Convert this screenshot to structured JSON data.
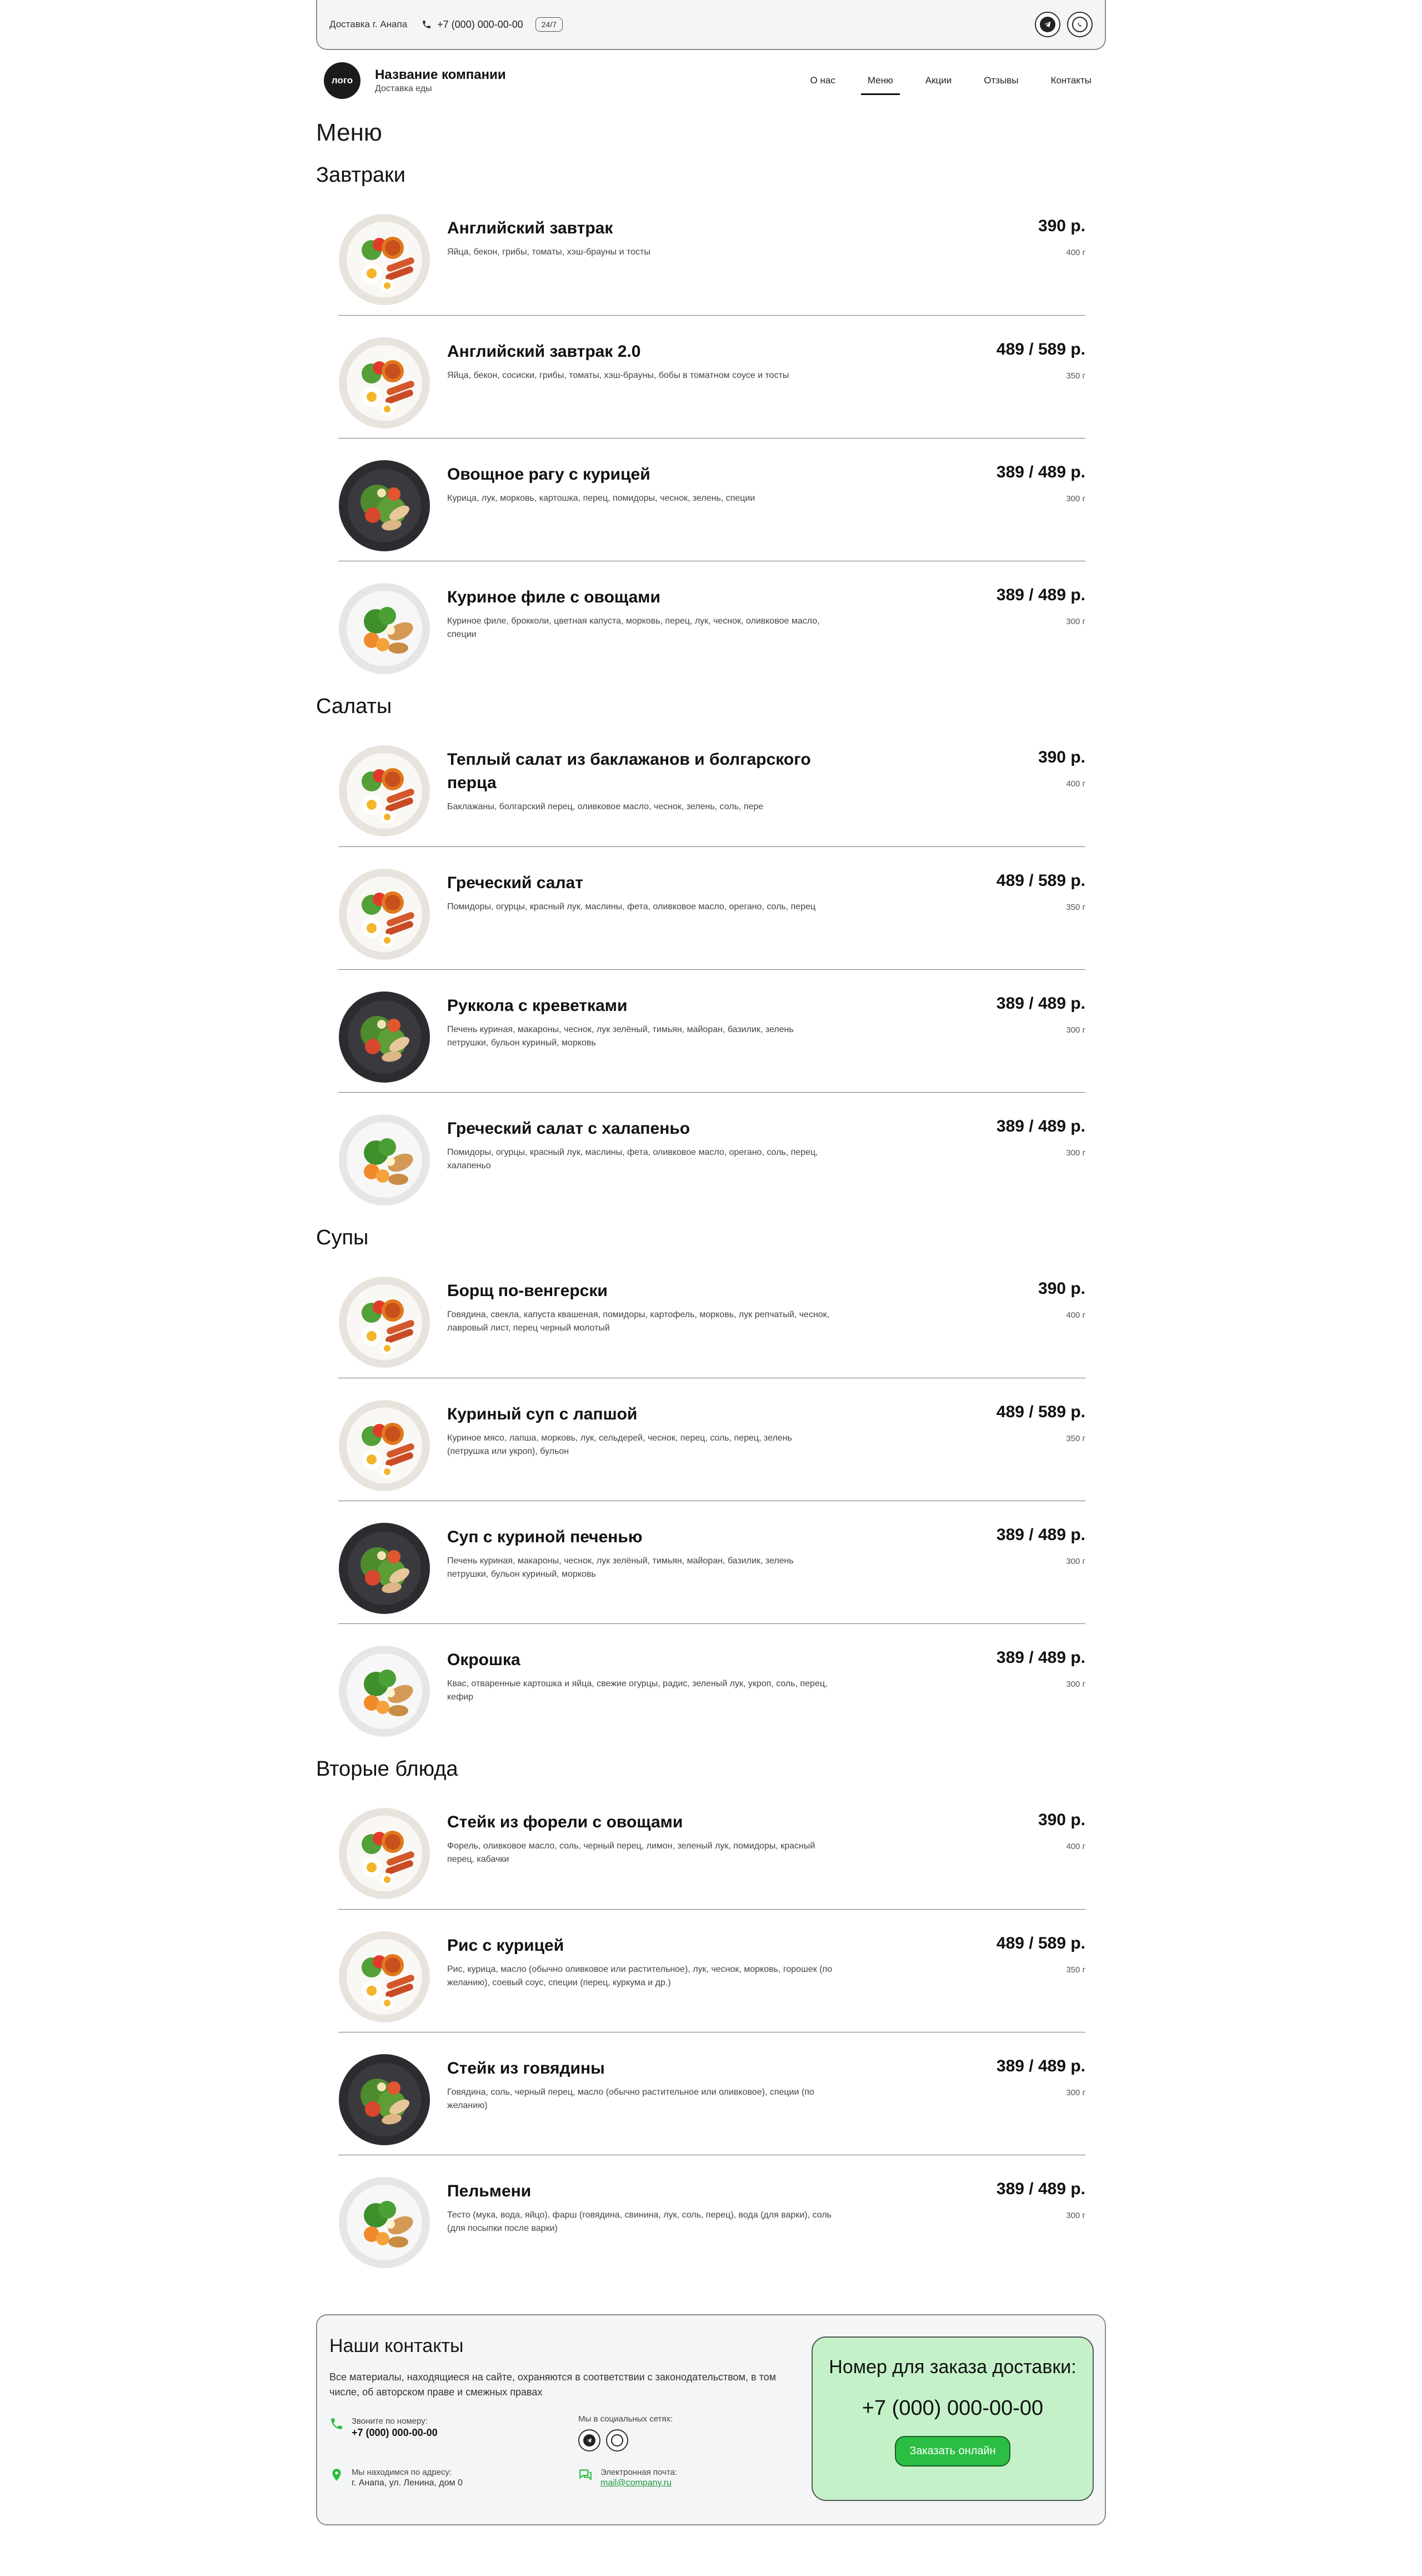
{
  "topbar": {
    "city": "Доставка г. Анапа",
    "phone": "+7 (000) 000-00-00",
    "badge": "24/7",
    "socials": [
      "telegram-icon",
      "whatsapp-icon"
    ]
  },
  "header": {
    "logo": "лого",
    "company_name": "Название компании",
    "company_sub": "Доставка еды",
    "nav": [
      {
        "label": "О нас",
        "active": false
      },
      {
        "label": "Меню",
        "active": true
      },
      {
        "label": "Акции",
        "active": false
      },
      {
        "label": "Отзывы",
        "active": false
      },
      {
        "label": "Контакты",
        "active": false
      }
    ]
  },
  "page_title": "Меню",
  "categories": [
    {
      "title": "Завтраки",
      "dishes": [
        {
          "title": "Английский завтрак",
          "desc": "Яйца, бекон, грибы, томаты, хэш-брауны и тосты",
          "price": "390 р.",
          "weight": "400 г",
          "plate": "light-breakfast"
        },
        {
          "title": "Английский завтрак 2.0",
          "desc": "Яйца, бекон, сосиски, грибы, томаты, хэш-брауны, бобы в томатном соусе и тосты",
          "price": "489 / 589 р.",
          "weight": "350 г",
          "plate": "light-breakfast"
        },
        {
          "title": "Овощное рагу с курицей",
          "desc": "Курица, лук, морковь, картошка, перец, помидоры, чеснок, зелень, специи",
          "price": "389 / 489 р.",
          "weight": "300 г",
          "plate": "dark-salad"
        },
        {
          "title": "Куриное филе с овощами",
          "desc": "Куриное филе, брокколи, цветная капуста, морковь, перец, лук, чеснок, оливковое масло, специи",
          "price": "389 / 489 р.",
          "weight": "300 г",
          "plate": "light-veg"
        }
      ]
    },
    {
      "title": "Салаты",
      "dishes": [
        {
          "title": "Теплый салат из баклажанов и болгарского перца",
          "desc": "Баклажаны, болгарский перец, оливковое масло, чеснок, зелень, соль, пере",
          "price": "390 р.",
          "weight": "400 г",
          "plate": "light-breakfast"
        },
        {
          "title": "Греческий салат",
          "desc": "Помидоры, огурцы, красный лук, маслины, фета, оливковое масло, орегано, соль, перец",
          "price": "489 / 589 р.",
          "weight": "350 г",
          "plate": "light-breakfast"
        },
        {
          "title": "Руккола с креветками",
          "desc": "Печень куриная, макароны, чеснок, лук зелёный, тимьян, майоран, базилик, зелень петрушки, бульон куриный, морковь",
          "price": "389 / 489 р.",
          "weight": "300 г",
          "plate": "dark-salad"
        },
        {
          "title": "Греческий салат с халапеньо",
          "desc": "Помидоры, огурцы, красный лук, маслины, фета, оливковое масло, орегано, соль, перец, халапеньо",
          "price": "389 / 489 р.",
          "weight": "300 г",
          "plate": "light-veg"
        }
      ]
    },
    {
      "title": "Супы",
      "dishes": [
        {
          "title": "Борщ по-венгерски",
          "desc": "Говядина, свекла, капуста квашеная, помидоры, картофель, морковь, лук репчатый, чеснок, лавровый лист, перец черный молотый",
          "price": "390 р.",
          "weight": "400 г",
          "plate": "light-breakfast"
        },
        {
          "title": "Куриный суп с лапшой",
          "desc": "Куриное мясо, лапша, морковь, лук, сельдерей, чеснок, перец, соль, перец, зелень (петрушка или укроп), бульон",
          "price": "489 / 589 р.",
          "weight": "350 г",
          "plate": "light-breakfast"
        },
        {
          "title": "Суп с куриной печенью",
          "desc": "Печень куриная, макароны, чеснок, лук зелёный, тимьян, майоран, базилик, зелень петрушки, бульон куриный, морковь",
          "price": "389 / 489 р.",
          "weight": "300 г",
          "plate": "dark-salad"
        },
        {
          "title": "Окрошка",
          "desc": "Квас, отваренные картошка и яйца, свежие огурцы, радис, зеленый лук, укроп, соль, перец, кефир",
          "price": "389 / 489 р.",
          "weight": "300 г",
          "plate": "light-veg"
        }
      ]
    },
    {
      "title": "Вторые блюда",
      "dishes": [
        {
          "title": "Стейк из форели с овощами",
          "desc": "Форель, оливковое масло, соль, черный перец, лимон, зеленый лук, помидоры, красный перец, кабачки",
          "price": "390 р.",
          "weight": "400 г",
          "plate": "light-breakfast"
        },
        {
          "title": "Рис с курицей",
          "desc": "Рис, курица, масло (обычно оливковое или растительное), лук, чеснок, морковь, горошек (по желанию), соевый соус, специи (перец, куркума и др.)",
          "price": "489 / 589 р.",
          "weight": "350 г",
          "plate": "light-breakfast"
        },
        {
          "title": "Стейк из говядины",
          "desc": "Говядина, соль, черный перец, масло (обычно растительное или оливковое), специи (по желанию)",
          "price": "389 / 489 р.",
          "weight": "300 г",
          "plate": "dark-salad"
        },
        {
          "title": "Пельмени",
          "desc": "Тесто (мука, вода, яйцо), фарш (говядина, свинина, лук, соль, перец), вода (для варки), соль (для посыпки после варки)",
          "price": "389 / 489 р.",
          "weight": "300 г",
          "plate": "light-veg"
        }
      ]
    }
  ],
  "footer": {
    "title": "Наши контакты",
    "note": "Все материалы, находящиеся на сайте, охраняются в соответствии с законодательством, в том числе, об авторском праве и смежных правах",
    "call_label": "Звоните по номеру:",
    "call_value": "+7 (000) 000-00-00",
    "social_label": "Мы в социальных сетях:",
    "address_label": "Мы находимся по адресу:",
    "address_value": "г. Анапа, ул. Ленина, дом 0",
    "email_label": "Электронная почта:",
    "email_value": "mail@company.ru",
    "order_title": "Номер для заказа доставки:",
    "order_phone": "+7 (000) 000-00-00",
    "order_button": "Заказать онлайн"
  },
  "colors": {
    "accent_green": "#2bbd44",
    "card_green": "#c4f1c8",
    "panel_bg": "#f4f5f7"
  }
}
